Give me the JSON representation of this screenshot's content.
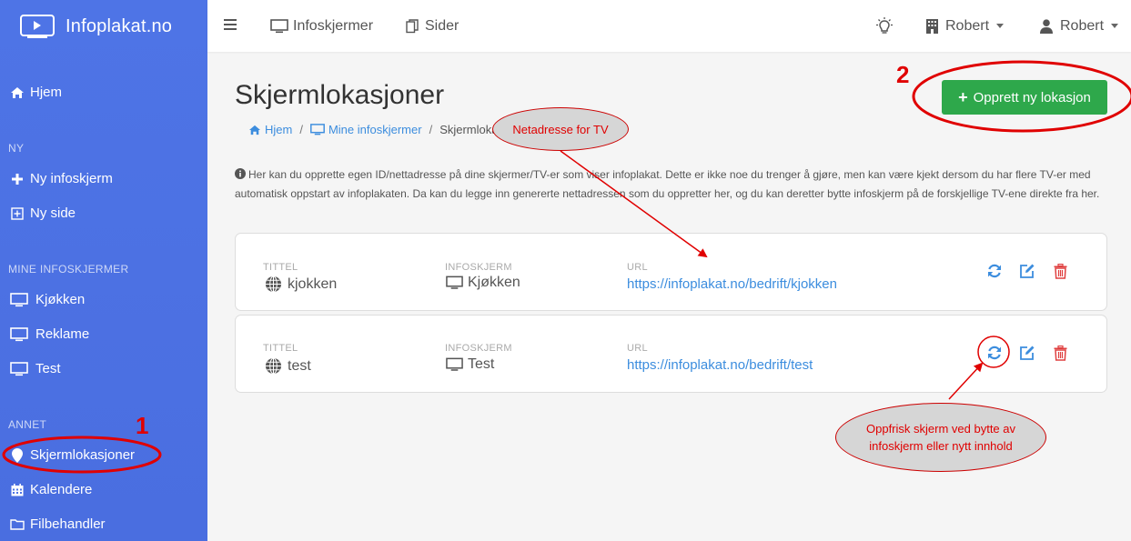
{
  "brand": {
    "name": "Infoplakat.no"
  },
  "sidebar": {
    "home": "Hjem",
    "section_ny": "NY",
    "new_items": [
      "Ny infoskjerm",
      "Ny side"
    ],
    "section_mine": "MINE INFOSKJERMER",
    "screens": [
      "Kjøkken",
      "Reklame",
      "Test"
    ],
    "section_annet": "ANNET",
    "other": [
      "Skjermlokasjoner",
      "Kalendere",
      "Filbehandler"
    ]
  },
  "topbar": {
    "infoskjermer": "Infoskjermer",
    "sider": "Sider",
    "company": "Robert",
    "user": "Robert"
  },
  "page": {
    "title": "Skjermlokasjoner",
    "breadcrumb": [
      "Hjem",
      "Mine infoskjermer",
      "Skjermlokasjoner"
    ],
    "info": "Her kan du opprette egen ID/nettadresse på dine skjermer/TV-er som viser infoplakat. Dette er ikke noe du trenger å gjøre, men kan være kjekt dersom du har flere TV-er med automatisk oppstart av infoplakaten. Da kan du legge inn genererte nettadressen som du oppretter her, og du kan deretter bytte infoskjerm på de forskjellige TV-ene direkte fra her.",
    "create_button": "Opprett ny lokasjon"
  },
  "columns": {
    "title": "TITTEL",
    "screen": "INFOSKJERM",
    "url": "URL"
  },
  "locations": [
    {
      "title": "kjokken",
      "screen": "Kjøkken",
      "url": "https://infoplakat.no/bedrift/kjokken"
    },
    {
      "title": "test",
      "screen": "Test",
      "url": "https://infoplakat.no/bedrift/test"
    }
  ],
  "annotations": {
    "tv_note": "Netadresse for TV",
    "refresh_note": "Oppfrisk skjerm ved bytte av infoskjerm eller nytt innhold",
    "marker_1": "1",
    "marker_2": "2"
  },
  "colors": {
    "sidebar": "#4e74e6",
    "primary": "#3c8dde",
    "success": "#2ea84b",
    "danger": "#e04040",
    "annotation": "#e00000"
  }
}
